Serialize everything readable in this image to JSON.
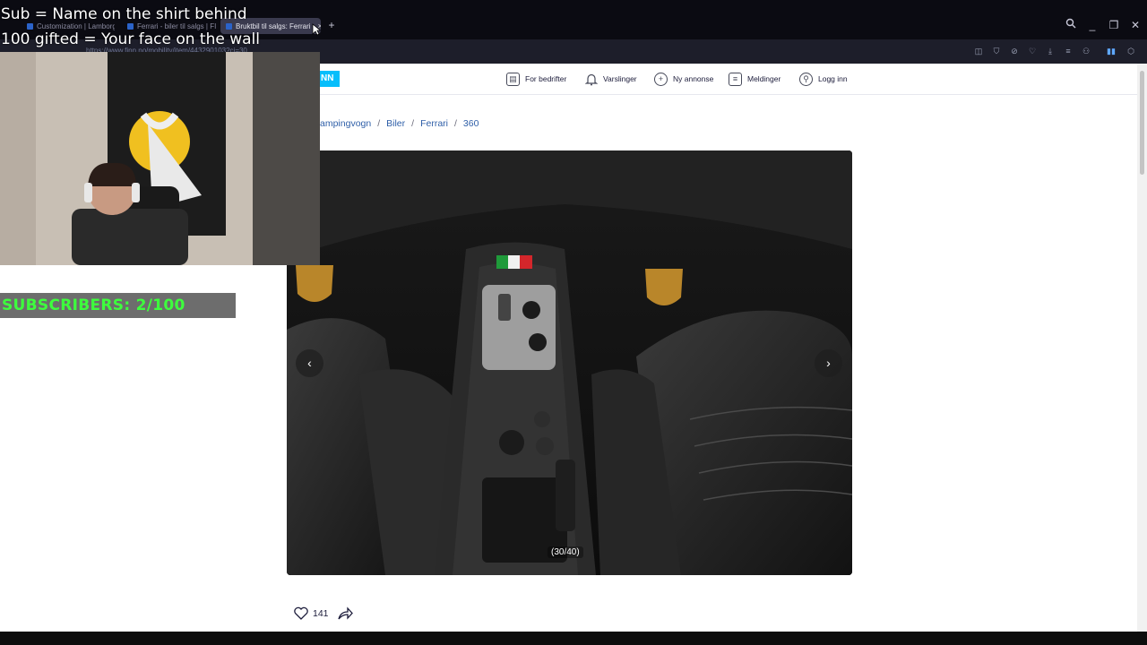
{
  "browser": {
    "tabs": [
      {
        "label": "Customization | Lamborg"
      },
      {
        "label": "Ferrari - biler til salgs | FI"
      },
      {
        "label": "Bruktbil til salgs: Ferrari"
      }
    ],
    "url": "https://www.finn.no/mobility/item/443290103?ci=30"
  },
  "site": {
    "logo": "NN",
    "nav": [
      {
        "label": "For bedrifter",
        "icon": "building-icon"
      },
      {
        "label": "Varslinger",
        "icon": "bell-icon"
      },
      {
        "label": "Ny annonse",
        "icon": "plus-circle-icon"
      },
      {
        "label": "Meldinger",
        "icon": "chat-icon"
      },
      {
        "label": "Logg inn",
        "icon": "user-icon"
      }
    ]
  },
  "breadcrumbs": [
    "ampingvogn",
    "Biler",
    "Ferrari",
    "360"
  ],
  "gallery": {
    "counter": "(30/40)"
  },
  "favorites": {
    "count": "141"
  },
  "overlay": {
    "line1": "Sub = Name on the shirt behind",
    "line2": "100 gifted = Your face on the wall",
    "subscribers": "SUBSCRIBERS: 2/100"
  },
  "colors": {
    "brand": "#06befb",
    "link": "#2f5fa8",
    "sub_text": "#3dff3d"
  }
}
